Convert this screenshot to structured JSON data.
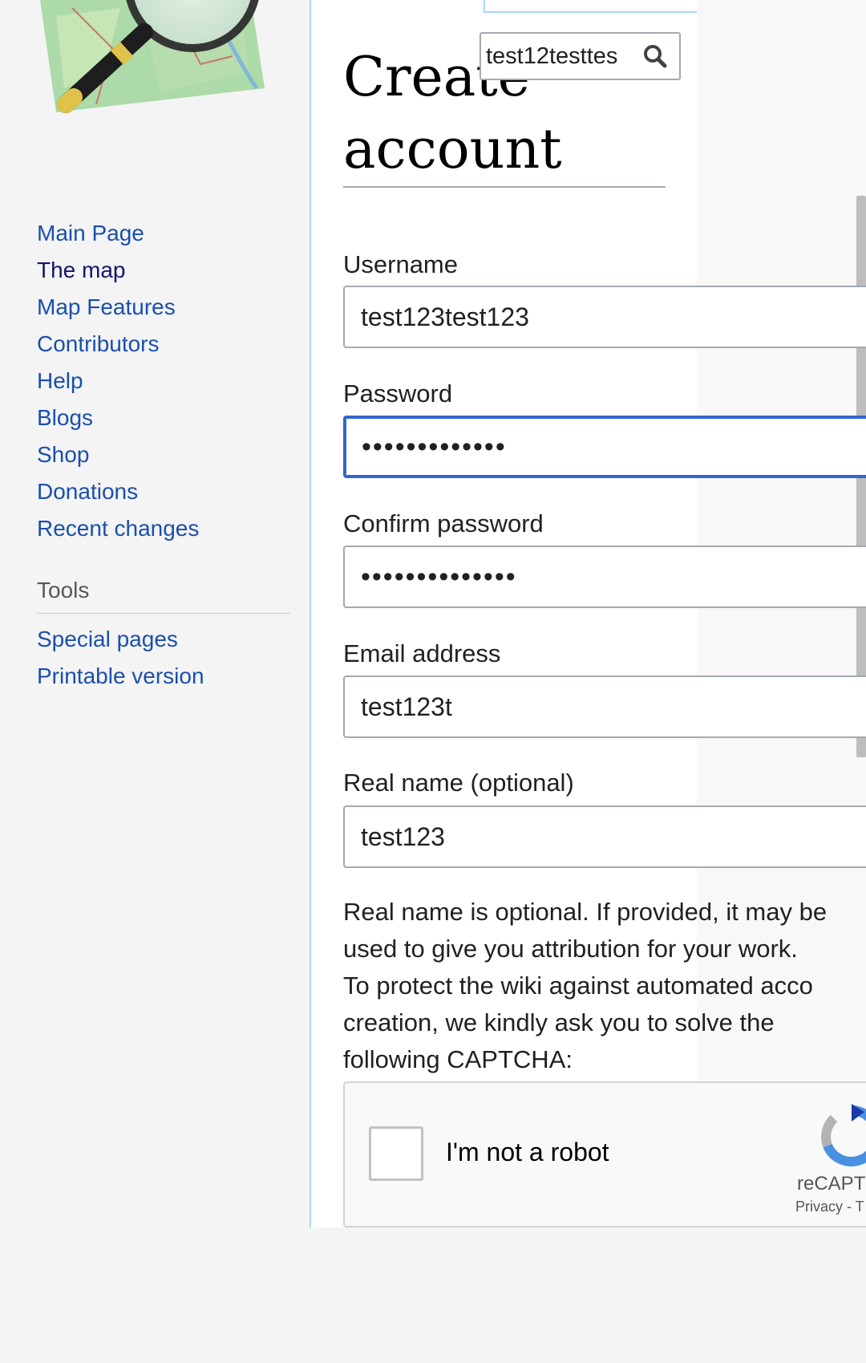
{
  "sidebar": {
    "nav_items": [
      {
        "label": "Main Page"
      },
      {
        "label": "The map"
      },
      {
        "label": "Map Features"
      },
      {
        "label": "Contributors"
      },
      {
        "label": "Help"
      },
      {
        "label": "Blogs"
      },
      {
        "label": "Shop"
      },
      {
        "label": "Donations"
      },
      {
        "label": "Recent changes"
      }
    ],
    "tools_heading": "Tools",
    "tools_items": [
      {
        "label": "Special pages"
      },
      {
        "label": "Printable version"
      }
    ]
  },
  "search": {
    "value": "test12testtes",
    "icon": "search-icon"
  },
  "page": {
    "title": "Create account"
  },
  "form": {
    "username_label": "Username",
    "username_value": "test123test123",
    "password_label": "Password",
    "password_value": "•••••••••••••",
    "confirm_label": "Confirm password",
    "confirm_value": "••••••••••••••",
    "email_label": "Email address",
    "email_value": "test123t",
    "realname_label": "Real name (optional)",
    "realname_value": "test123"
  },
  "help": {
    "line1": "Real name is optional. If provided, it may be",
    "line2": "used to give you attribution for your work.",
    "line3": "To protect the wiki against automated acco",
    "line4": "creation, we kindly ask you to solve the",
    "line5": "following CAPTCHA:"
  },
  "captcha": {
    "label": "I'm not a robot",
    "brand": "reCAPTC",
    "links": "Privacy - T"
  },
  "colors": {
    "link": "#1a4fae",
    "visited_link": "#14146e",
    "focus": "#3366cc",
    "border": "#a2a9b1"
  }
}
